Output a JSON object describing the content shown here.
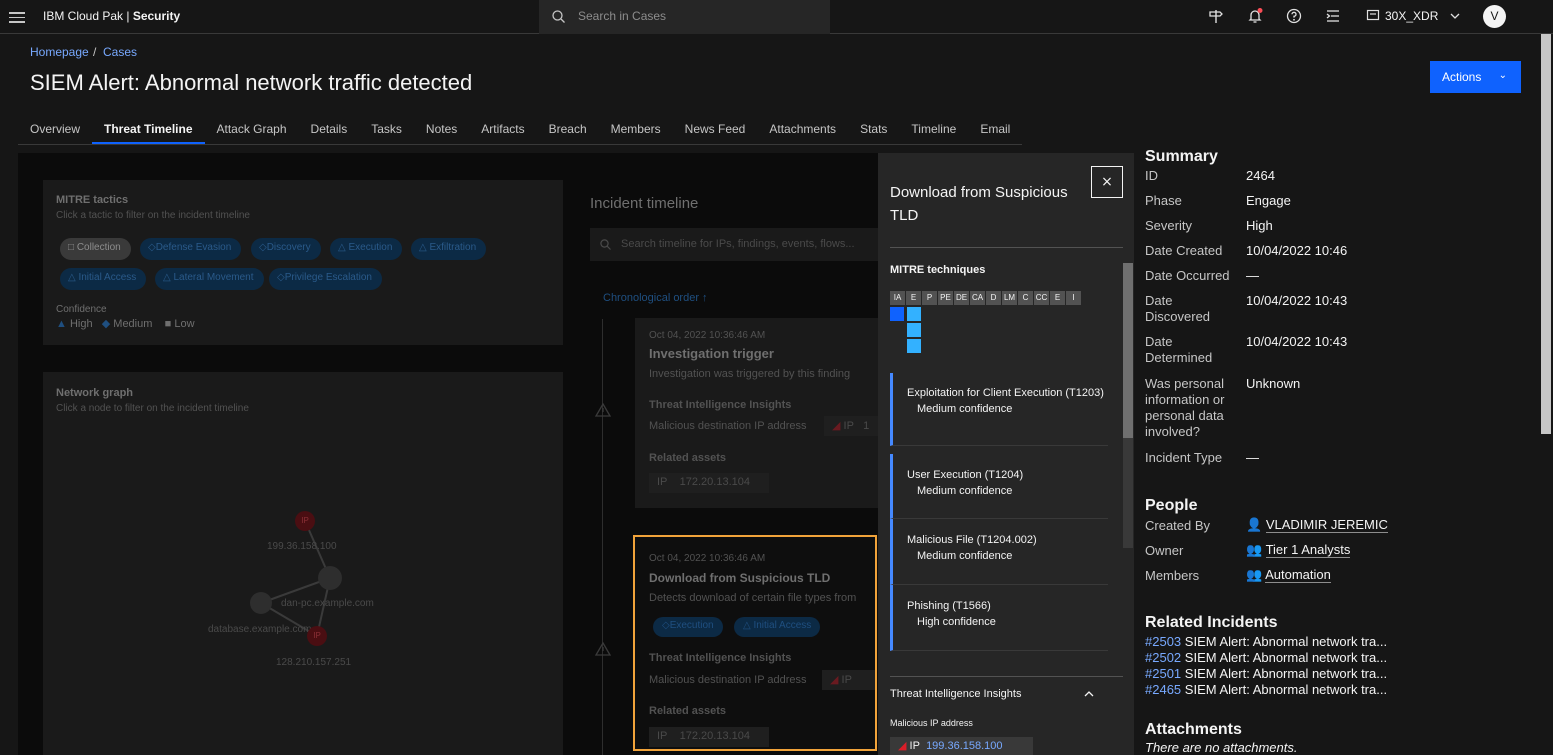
{
  "header": {
    "brand_prefix": "IBM Cloud Pak |",
    "brand_bold": "Security",
    "search_placeholder": "Search in Cases",
    "account": "30X_XDR",
    "avatar_initial": "V"
  },
  "breadcrumb": {
    "home": "Homepage",
    "separator": "/",
    "cases": "Cases"
  },
  "page_title": "SIEM Alert: Abnormal network traffic detected",
  "actions_label": "Actions",
  "tabs": [
    "Overview",
    "Threat Timeline",
    "Attack Graph",
    "Details",
    "Tasks",
    "Notes",
    "Artifacts",
    "Breach",
    "Members",
    "News Feed",
    "Attachments",
    "Stats",
    "Timeline",
    "Email"
  ],
  "active_tab": "Threat Timeline",
  "mitre_tactics": {
    "title": "MITRE tactics",
    "subtitle": "Click a tactic to filter on the incident timeline",
    "chips": [
      "Collection",
      "Defense Evasion",
      "Discovery",
      "Execution",
      "Exfiltration",
      "Initial Access",
      "Lateral Movement",
      "Privilege Escalation"
    ],
    "confidence_label": "Confidence",
    "legend": [
      "High",
      "Medium",
      "Low"
    ]
  },
  "network_graph": {
    "title": "Network graph",
    "subtitle": "Click a node to filter on the incident timeline",
    "node_tag": "IP",
    "nodes": [
      "199.36.158.100",
      "dan-pc.example.com",
      "database.example.com",
      "128.210.157.251"
    ]
  },
  "incident_timeline": {
    "title": "Incident timeline",
    "search_placeholder": "Search timeline for IPs, findings, events, flows...",
    "order": "Chronological order",
    "events": [
      {
        "time": "Oct 04, 2022 10:36:46 AM",
        "title": "Investigation trigger",
        "desc": "Investigation was triggered by this finding",
        "insights_label": "Threat Intelligence Insights",
        "insight": "Malicious destination IP address",
        "ip_tag": "IP",
        "ip_suffix": "1",
        "assets_label": "Related assets",
        "asset_tag": "IP",
        "asset": "172.20.13.104"
      },
      {
        "time": "Oct 04, 2022 10:36:46 AM",
        "title": "Download from Suspicious TLD",
        "desc": "Detects download of certain file types from",
        "tags": [
          "Execution",
          "Initial Access"
        ],
        "insights_label": "Threat Intelligence Insights",
        "insight": "Malicious destination IP address",
        "ip_tag": "IP",
        "assets_label": "Related assets",
        "asset_tag": "IP",
        "asset": "172.20.13.104"
      }
    ]
  },
  "side_panel": {
    "title": "Download from Suspicious TLD",
    "close": "×",
    "techniques_label": "MITRE techniques",
    "matrix_cols": [
      "IA",
      "E",
      "P",
      "PE",
      "DE",
      "CA",
      "D",
      "LM",
      "C",
      "CC",
      "E",
      "I"
    ],
    "techniques": [
      {
        "name": "Exploitation for Client Execution (T1203)",
        "confidence": "Medium confidence"
      },
      {
        "name": "User Execution (T1204)",
        "confidence": "Medium confidence"
      },
      {
        "name": "Malicious File (T1204.002)",
        "confidence": "Medium confidence"
      },
      {
        "name": "Phishing (T1566)",
        "confidence": "High confidence"
      }
    ],
    "insights_label": "Threat Intelligence Insights",
    "malicious_ip_label": "Malicious IP address",
    "ip_tag": "IP",
    "ip": "199.36.158.100"
  },
  "summary": {
    "title": "Summary",
    "rows": [
      {
        "label": "ID",
        "value": "2464"
      },
      {
        "label": "Phase",
        "value": "Engage"
      },
      {
        "label": "Severity",
        "value": "High"
      },
      {
        "label": "Date Created",
        "value": "10/04/2022 10:46"
      },
      {
        "label": "Date Occurred",
        "value": "—"
      },
      {
        "label": "Date Discovered",
        "value": "10/04/2022 10:43"
      },
      {
        "label": "Date Determined",
        "value": "10/04/2022 10:43"
      },
      {
        "label": "Was personal information or personal data involved?",
        "value": "Unknown"
      },
      {
        "label": "Incident Type",
        "value": "—"
      }
    ]
  },
  "people": {
    "title": "People",
    "created_by_label": "Created By",
    "created_by": "VLADIMIR JEREMIC",
    "owner_label": "Owner",
    "owner": "Tier 1 Analysts",
    "members_label": "Members",
    "members": "Automation"
  },
  "related_incidents": {
    "title": "Related Incidents",
    "items": [
      {
        "id": "#2503",
        "name": "SIEM Alert: Abnormal network tra..."
      },
      {
        "id": "#2502",
        "name": "SIEM Alert: Abnormal network tra..."
      },
      {
        "id": "#2501",
        "name": "SIEM Alert: Abnormal network tra..."
      },
      {
        "id": "#2465",
        "name": "SIEM Alert: Abnormal network tra..."
      }
    ]
  },
  "attachments": {
    "title": "Attachments",
    "empty": "There are no attachments."
  },
  "colors": {
    "accent": "#0f62fe",
    "highlight_border": "#f1a33a",
    "technique": "#33b1ff",
    "link": "#78a9ff"
  }
}
